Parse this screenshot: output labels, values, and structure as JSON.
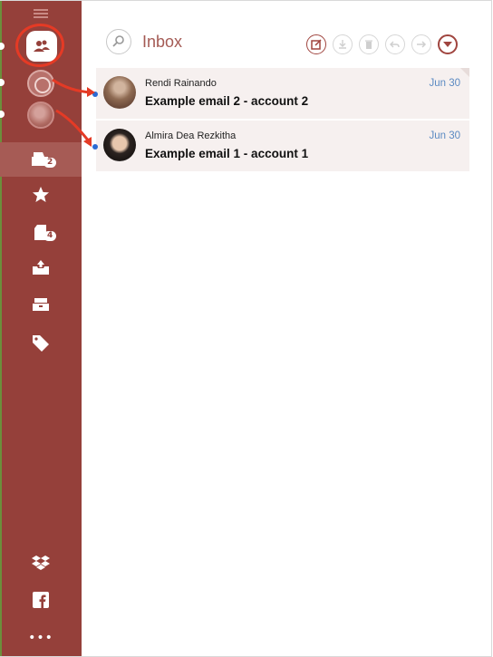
{
  "header": {
    "title": "Inbox"
  },
  "sidebar": {
    "nav": [
      {
        "name": "inbox",
        "badge": "2"
      },
      {
        "name": "starred",
        "badge": ""
      },
      {
        "name": "drafts",
        "badge": "4"
      },
      {
        "name": "sent",
        "badge": ""
      },
      {
        "name": "archive",
        "badge": ""
      },
      {
        "name": "tags",
        "badge": ""
      }
    ],
    "bottom": [
      "dropbox",
      "facebook",
      "more"
    ],
    "more_label": "•••"
  },
  "emails": [
    {
      "sender": "Rendi Rainando",
      "subject": "Example email 2 - account 2",
      "date": "Jun 30"
    },
    {
      "sender": "Almira Dea Rezkitha",
      "subject": "Example email 1 - account 1",
      "date": "Jun 30"
    }
  ],
  "colors": {
    "sidebar": "#95403a",
    "accent": "#a0453f",
    "annotation": "#e53a25",
    "date": "#5b8ac2"
  }
}
